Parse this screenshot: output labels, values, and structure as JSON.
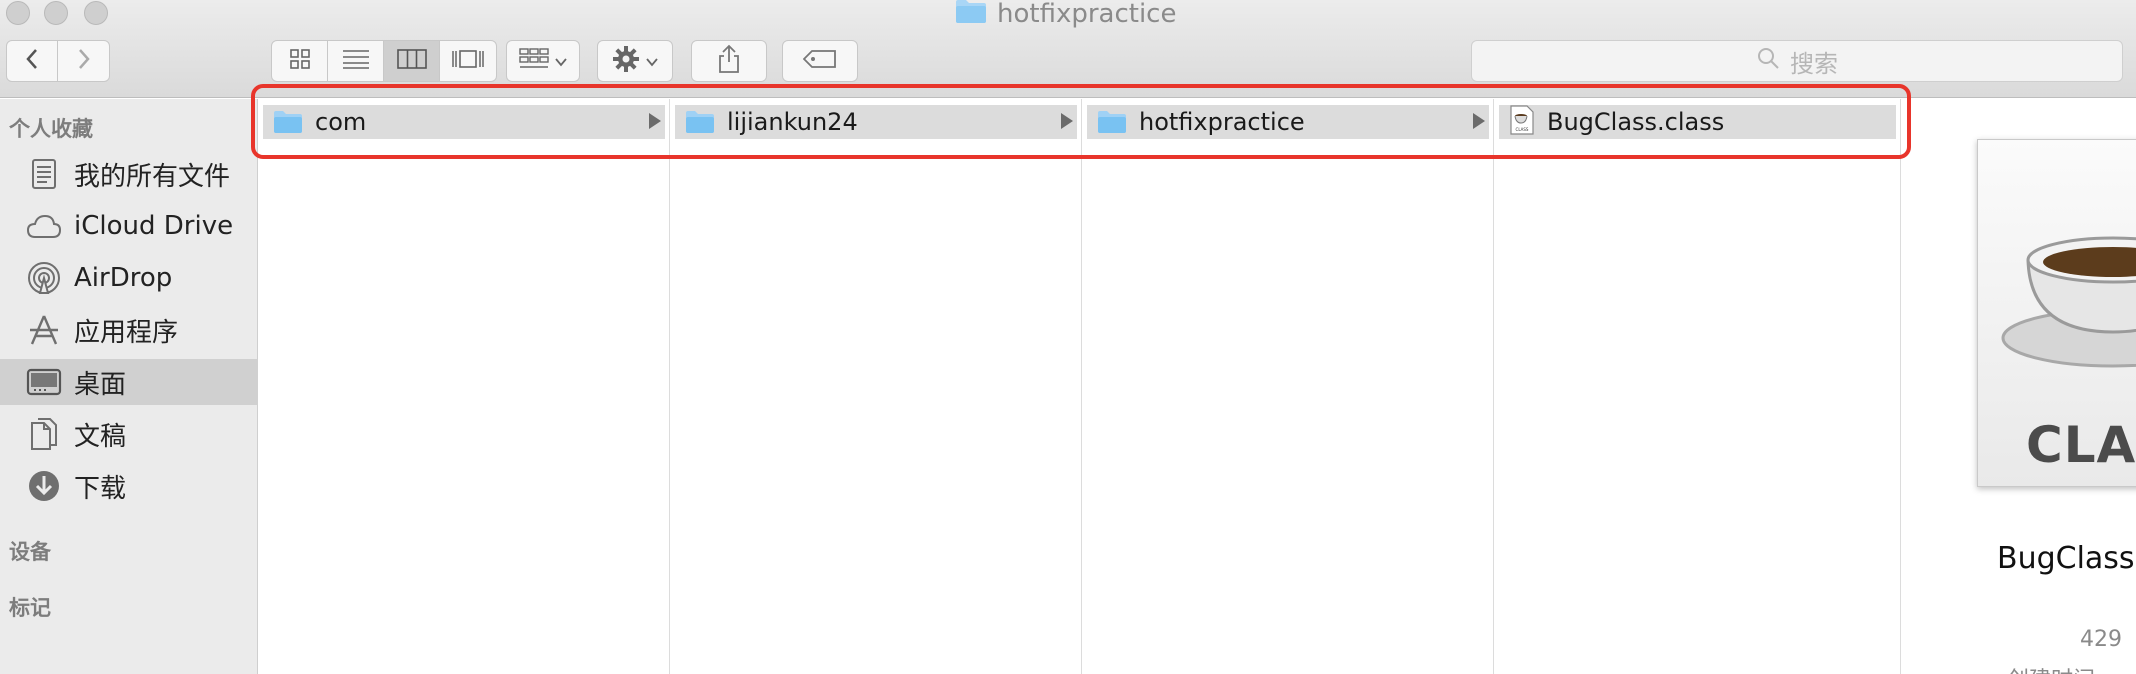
{
  "window": {
    "title": "hotfixpractice"
  },
  "toolbar": {
    "search_placeholder": "搜索",
    "view_modes": [
      "icon-view",
      "list-view",
      "column-view",
      "cover-flow-view"
    ],
    "active_view": "column-view"
  },
  "sidebar": {
    "sections": {
      "favorites": "个人收藏",
      "devices": "设备",
      "tags": "标记"
    },
    "items": [
      {
        "label": "我的所有文件",
        "icon": "all-files-icon"
      },
      {
        "label": "iCloud Drive",
        "icon": "cloud-icon"
      },
      {
        "label": "AirDrop",
        "icon": "airdrop-icon"
      },
      {
        "label": "应用程序",
        "icon": "applications-icon"
      },
      {
        "label": "桌面",
        "icon": "desktop-icon",
        "selected": true
      },
      {
        "label": "文稿",
        "icon": "documents-icon"
      },
      {
        "label": "下载",
        "icon": "download-icon"
      }
    ]
  },
  "columns": [
    {
      "label": "com",
      "icon": "folder-icon"
    },
    {
      "label": "lijiankun24",
      "icon": "folder-icon"
    },
    {
      "label": "hotfixpractice",
      "icon": "folder-icon"
    },
    {
      "label": "BugClass.class",
      "icon": "class-file-icon"
    }
  ],
  "preview": {
    "badge_text": "CLASS",
    "file_name": "BugClass",
    "size_text": "429",
    "created_label": "创建时间"
  },
  "colors": {
    "highlight": "#e8352b",
    "folder": "#79c2f2",
    "selection": "#dcdcdc"
  }
}
